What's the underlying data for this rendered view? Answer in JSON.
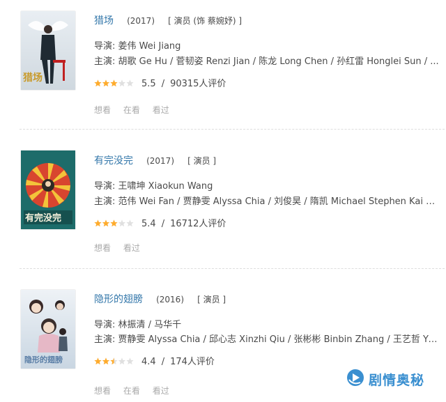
{
  "items": [
    {
      "title": "猎场",
      "year": "(2017)",
      "role": "[ 演员 (饰 蔡婉妤) ]",
      "director_label": "导演:",
      "director": "姜伟 Wei Jiang",
      "cast_label": "主演:",
      "cast": "胡歌 Ge Hu / 菅韧姿 Renzi Jian / 陈龙 Long Chen / 孙红雷 Honglei Sun / ...",
      "stars": 3,
      "score": "5.5",
      "votes": "90315人评价",
      "actions": [
        "想看",
        "在看",
        "看过"
      ],
      "poster_text": "猎场"
    },
    {
      "title": "有完没完",
      "year": "(2017)",
      "role": "[ 演员 ]",
      "director_label": "导演:",
      "director": "王啸坤 Xiaokun Wang",
      "cast_label": "主演:",
      "cast": "范伟 Wei Fan / 贾静雯 Alyssa Chia / 刘俊昊 / 隋凯 Michael Stephen Kai Su...",
      "stars": 3,
      "score": "5.4",
      "votes": "16712人评价",
      "actions": [
        "想看",
        "看过"
      ],
      "poster_text": "有完没完"
    },
    {
      "title": "隐形的翅膀",
      "year": "(2016)",
      "role": "[ 演员 ]",
      "director_label": "导演:",
      "director": "林振清 / 马华千",
      "cast_label": "主演:",
      "cast": "贾静雯 Alyssa Chia / 邱心志 Xinzhi Qiu / 张彬彬 Binbin Zhang / 王艺哲 Yi...",
      "stars": 2.5,
      "score": "4.4",
      "votes": "174人评价",
      "actions": [
        "想看",
        "在看",
        "看过"
      ],
      "poster_text": "隐形的翅膀"
    }
  ],
  "watermark": {
    "text": "剧情奥秘"
  },
  "colors": {
    "link": "#3377aa",
    "star": "#ffac2d",
    "star_empty": "#e0e0e0",
    "muted": "#aaaaaa"
  }
}
